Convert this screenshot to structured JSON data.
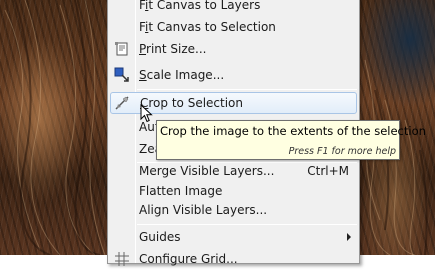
{
  "menu": {
    "items": [
      {
        "label": "Fit Canvas to Layers",
        "mnemonic_index": 1,
        "icon": ""
      },
      {
        "label": "Fit Canvas to Selection",
        "mnemonic_index": 1,
        "icon": ""
      },
      {
        "label": "Print Size...",
        "mnemonic_index": 0,
        "icon": "print-size-icon"
      },
      {
        "label": "Scale Image...",
        "mnemonic_index": 0,
        "icon": "scale-image-icon"
      },
      {
        "label": "Crop to Selection",
        "mnemonic_index": 0,
        "icon": "crop-icon"
      },
      {
        "label": "Aut",
        "icon": ""
      },
      {
        "label": "Zea",
        "icon": ""
      },
      {
        "label": "Merge Visible Layers...",
        "shortcut": "Ctrl+M",
        "icon": ""
      },
      {
        "label": "Flatten Image",
        "icon": ""
      },
      {
        "label": "Align Visible Layers...",
        "icon": ""
      },
      {
        "label": "Guides",
        "icon": "",
        "submenu": true
      },
      {
        "label": "Configure Grid...",
        "icon": "grid-icon"
      }
    ],
    "highlighted_index": 4
  },
  "tooltip": {
    "text": "Crop the image to the extents of the selection",
    "help": "Press F1 for more help"
  },
  "colors": {
    "menu_bg": "#f0f0f0",
    "highlight_bg": "#e2edf9",
    "highlight_border": "#a9c5e6",
    "tooltip_bg": "#ffffe1"
  }
}
